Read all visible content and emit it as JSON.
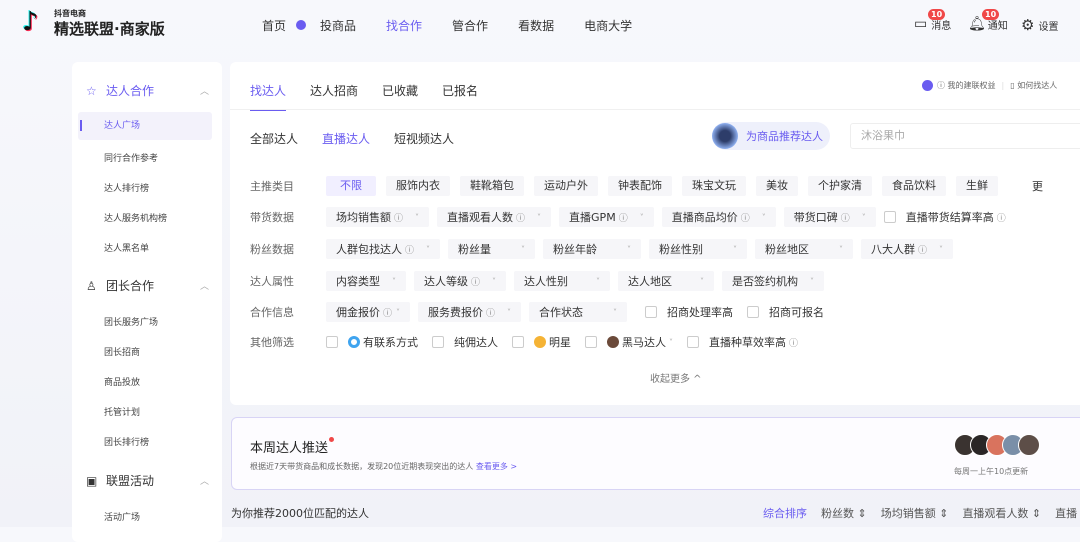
{
  "brand": {
    "small": "抖音电商",
    "title": "精选联盟·商家版"
  },
  "nav": {
    "items": [
      "首页",
      "投商品",
      "找合作",
      "管合作",
      "看数据",
      "电商大学"
    ],
    "active": 2
  },
  "topright": {
    "messages": "消息",
    "messages_badge": "10",
    "notify": "通知",
    "notify_badge": "10",
    "settings": "设置"
  },
  "sidebar": {
    "group1": {
      "label": "达人合作",
      "items": [
        "达人广场",
        "同行合作参考",
        "达人排行榜",
        "达人服务机构榜",
        "达人黑名单"
      ]
    },
    "group2": {
      "label": "团长合作",
      "items": [
        "团长服务广场",
        "团长招商",
        "商品投放",
        "托管计划",
        "团长排行榜"
      ]
    },
    "group3": {
      "label": "联盟活动",
      "items": [
        "活动广场"
      ]
    }
  },
  "main": {
    "tabs": [
      "找达人",
      "达人招商",
      "已收藏",
      "已报名"
    ],
    "links": {
      "rights": "我的建联权益",
      "howto": "如何找达人"
    },
    "subtabs": [
      "全部达人",
      "直播达人",
      "短视频达人"
    ],
    "recommend_btn": "为商品推荐达人",
    "search_placeholder": "沐浴果巾",
    "filters": {
      "category": {
        "label": "主推类目",
        "options": [
          "不限",
          "服饰内衣",
          "鞋靴箱包",
          "运动户外",
          "钟表配饰",
          "珠宝文玩",
          "美妆",
          "个护家清",
          "食品饮料",
          "生鲜"
        ],
        "more": "更"
      },
      "sales": {
        "label": "带货数据",
        "dropdowns": [
          "场均销售额",
          "直播观看人数",
          "直播GPM",
          "直播商品均价",
          "带货口碑"
        ],
        "checkbox": "直播带货结算率高"
      },
      "fans": {
        "label": "粉丝数据",
        "dropdowns": [
          "人群包找达人",
          "粉丝量",
          "粉丝年龄",
          "粉丝性别",
          "粉丝地区",
          "八大人群"
        ]
      },
      "attr": {
        "label": "达人属性",
        "dropdowns": [
          "内容类型",
          "达人等级",
          "达人性别",
          "达人地区",
          "是否签约机构"
        ]
      },
      "coop": {
        "label": "合作信息",
        "dropdowns": [
          "佣金报价",
          "服务费报价",
          "合作状态"
        ],
        "checkboxes": [
          "招商处理率高",
          "招商可报名"
        ]
      },
      "other": {
        "label": "其他筛选",
        "checkboxes": [
          "有联系方式",
          "纯佣达人",
          "明星",
          "黑马达人",
          "直播种草效率高"
        ]
      }
    },
    "collapse": "收起更多 ^"
  },
  "banner": {
    "title": "本周达人推送",
    "subtitle": "根据近7天带货商品和成长数据，发现20位近期表现突出的达人",
    "link": "查看更多 >",
    "update": "每周一上午10点更新"
  },
  "results": {
    "count": "为你推荐2000位匹配的达人",
    "sorts": [
      "综合排序",
      "粉丝数 ⇕",
      "场均销售额 ⇕",
      "直播观看人数 ⇕",
      "直播"
    ]
  }
}
